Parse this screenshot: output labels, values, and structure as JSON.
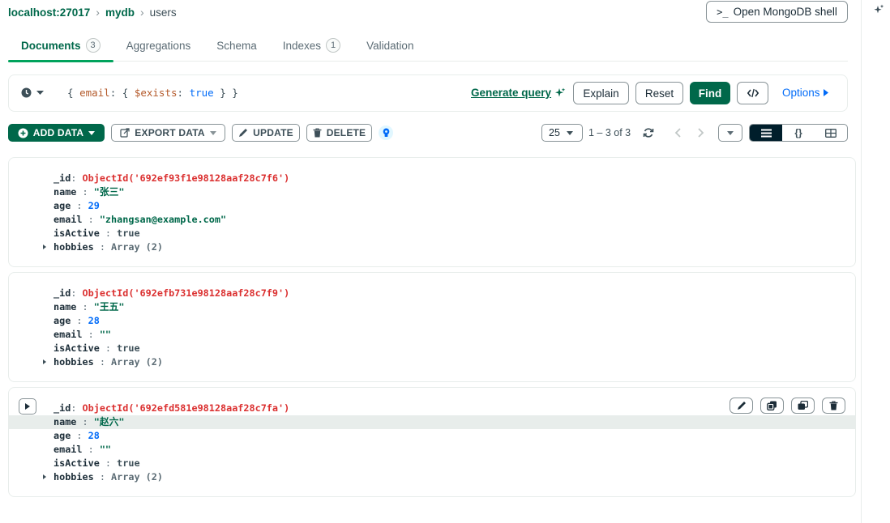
{
  "breadcrumb": {
    "host": "localhost:27017",
    "db": "mydb",
    "collection": "users"
  },
  "shell_button": {
    "prompt": ">_",
    "label": "Open MongoDB shell"
  },
  "tabs": [
    {
      "label": "Documents",
      "count": "3",
      "active": true
    },
    {
      "label": "Aggregations"
    },
    {
      "label": "Schema"
    },
    {
      "label": "Indexes",
      "count": "1"
    },
    {
      "label": "Validation"
    }
  ],
  "query": {
    "open": "{ ",
    "field": "email",
    "mid": ": { ",
    "operator": "$exists",
    "sep": ": ",
    "value": "true",
    "close": " } }",
    "generate_label": "Generate query",
    "explain_label": "Explain",
    "reset_label": "Reset",
    "find_label": "Find",
    "options_label": "Options"
  },
  "toolbar": {
    "add_label": "ADD DATA",
    "export_label": "EXPORT DATA",
    "update_label": "UPDATE",
    "delete_label": "DELETE"
  },
  "pagination": {
    "page_size": "25",
    "range_text": "1 – 3 of 3"
  },
  "view_options": {
    "list": "≡",
    "json": "{}",
    "table": "⊞"
  },
  "documents": [
    {
      "id": "ObjectId('692ef93f1e98128aaf28c7f6')",
      "name": "\"张三\"",
      "age": "29",
      "email": "\"zhangsan@example.com\"",
      "isActive": "true",
      "hobbies": "Array (2)"
    },
    {
      "id": "ObjectId('692efb731e98128aaf28c7f9')",
      "name": "\"王五\"",
      "age": "28",
      "email": "\"\"",
      "isActive": "true",
      "hobbies": "Array (2)"
    },
    {
      "id": "ObjectId('692efd581e98128aaf28c7fa')",
      "name": "\"赵六\"",
      "age": "28",
      "email": "\"\"",
      "isActive": "true",
      "hobbies": "Array (2)"
    }
  ],
  "field_keys": {
    "id": "_id",
    "name": "name",
    "age": "age",
    "email": "email",
    "isActive": "isActive",
    "hobbies": "hobbies"
  },
  "colors": {
    "brand_green": "#00684a",
    "accent_green": "#00a35c",
    "link_blue": "#016bf8",
    "objectid_red": "#db3030",
    "dark_navy": "#001e2b"
  },
  "icons": [
    "history-clock-icon",
    "sparkle-icon",
    "code-icon",
    "caret-right-icon",
    "plus-circle-icon",
    "export-icon",
    "pencil-icon",
    "trash-icon",
    "lightbulb-icon",
    "refresh-icon",
    "chevron-left-icon",
    "chevron-right-icon",
    "copy-icon",
    "clone-icon"
  ]
}
